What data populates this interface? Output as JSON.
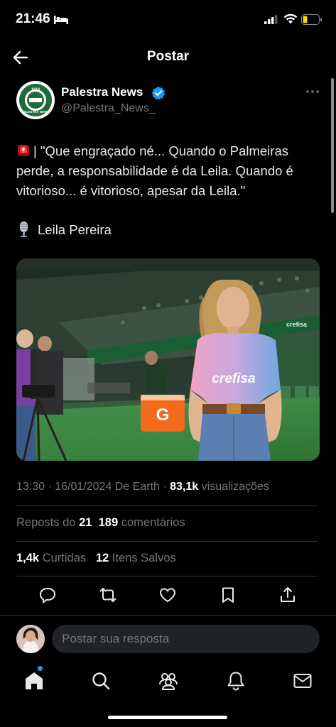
{
  "status_bar": {
    "time": "21:46"
  },
  "header": {
    "title": "Postar"
  },
  "post": {
    "author_name": "Palestra News",
    "author_handle": "@Palestra_News_",
    "avatar_text_top": "1914",
    "avatar_text_bottom": "PALESTRA NEWS",
    "text": "| \"Que engraçado né... Quando o Palmeiras perde, a responsabilidade é da Leila. Quando é vitorioso... é vitorioso, apesar da Leila.\"",
    "quote_author": "Leila Pereira",
    "image": {
      "jersey_text": "crefisa",
      "cooler_letter": "G",
      "board_text": "crefisa"
    }
  },
  "meta": {
    "time": "13:30",
    "date": "16/01/2024",
    "source": "De Earth",
    "views_count": "83,1k",
    "views_label": "visualizações"
  },
  "stats": {
    "reposts_label": "Reposts do",
    "reposts_count": "21",
    "comments_count": "189",
    "comments_label": "comentários",
    "likes_count": "1,4k",
    "likes_label": "Curtidas",
    "saves_count": "12",
    "saves_label": "Itens Salvos"
  },
  "reply": {
    "placeholder": "Postar sua resposta"
  },
  "colors": {
    "accent": "#1d9bf0",
    "background": "#000000",
    "muted": "#71767b",
    "verified": "#1d9bf0"
  },
  "icons": [
    "back-arrow-icon",
    "verified-badge-icon",
    "more-icon",
    "siren-icon",
    "microphone-icon",
    "reply-icon",
    "repost-icon",
    "like-icon",
    "bookmark-icon",
    "share-icon",
    "home-icon",
    "search-icon",
    "communities-icon",
    "notifications-icon",
    "messages-icon"
  ]
}
